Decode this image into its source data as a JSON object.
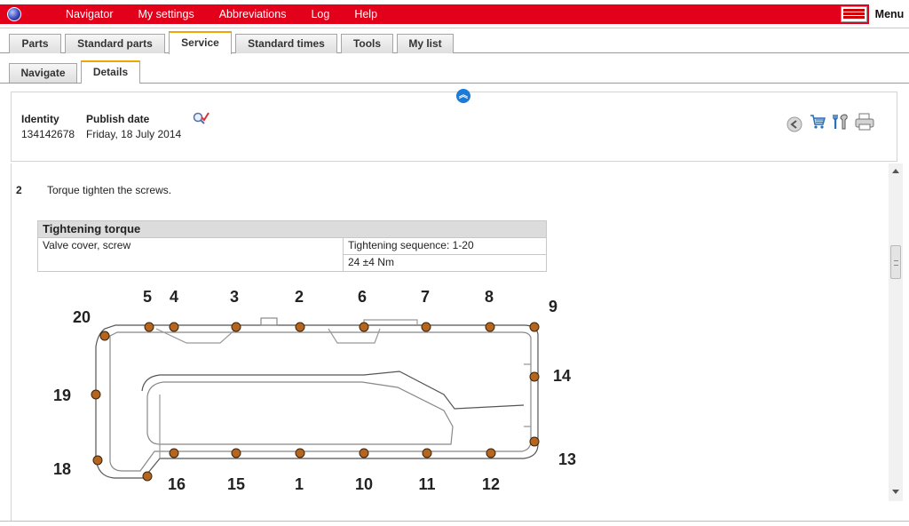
{
  "topbar": {
    "nav": [
      "Navigator",
      "My settings",
      "Abbreviations",
      "Log",
      "Help"
    ],
    "menu_label": "Menu"
  },
  "tabs": [
    {
      "label": "Parts",
      "active": false
    },
    {
      "label": "Standard parts",
      "active": false
    },
    {
      "label": "Service",
      "active": true
    },
    {
      "label": "Standard times",
      "active": false
    },
    {
      "label": "Tools",
      "active": false
    },
    {
      "label": "My list",
      "active": false
    }
  ],
  "subtabs": [
    {
      "label": "Navigate",
      "active": false
    },
    {
      "label": "Details",
      "active": true
    }
  ],
  "header": {
    "identity_label": "Identity",
    "identity_value": "134142678",
    "publish_label": "Publish date",
    "publish_value": "Friday, 18 July 2014"
  },
  "step": {
    "number": "2",
    "text": "Torque tighten the screws."
  },
  "torque_table": {
    "title": "Tightening torque",
    "item": "Valve cover, screw",
    "sequence": "Tightening sequence: 1-20",
    "value": "24 ±4 Nm"
  },
  "diagram": {
    "labels": [
      "5",
      "4",
      "3",
      "2",
      "6",
      "7",
      "8",
      "9",
      "20",
      "14",
      "19",
      "13",
      "18",
      "16",
      "15",
      "1",
      "10",
      "11",
      "12"
    ]
  },
  "colors": {
    "brand_red": "#e2001a",
    "tab_accent": "#f0a500",
    "bolt": "#b5651d"
  }
}
